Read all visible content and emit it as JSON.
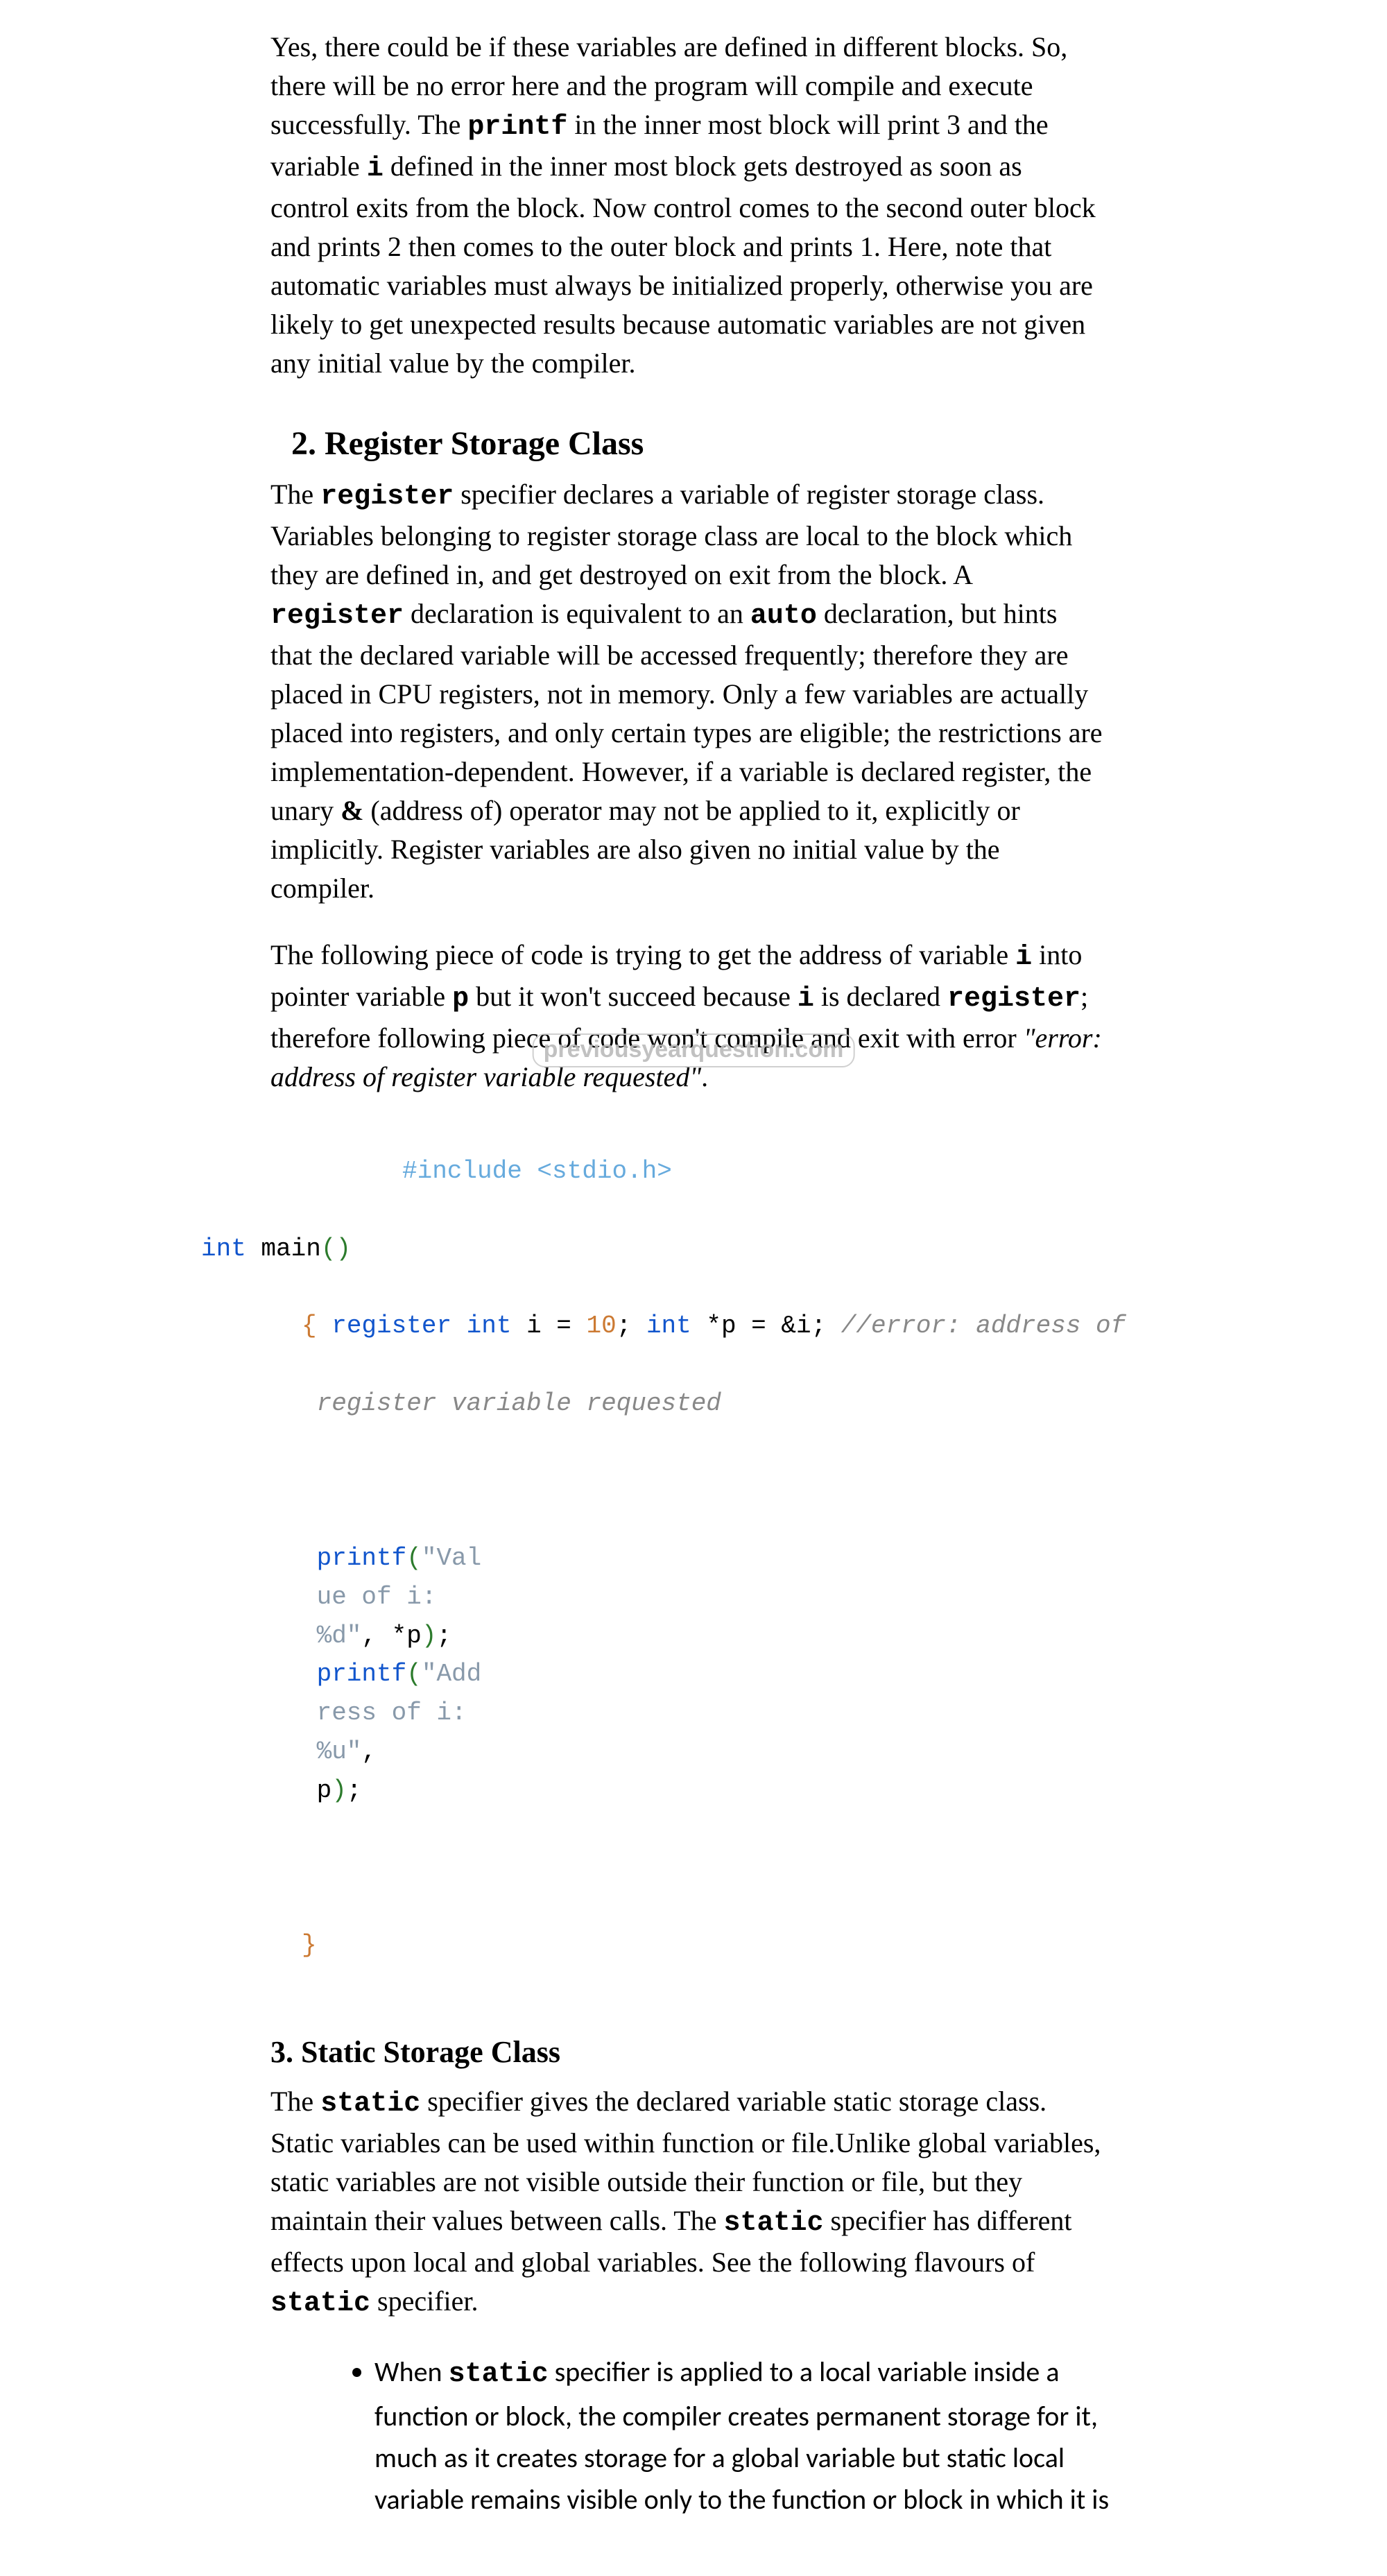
{
  "para1": {
    "t0": "Yes, there could be if these variables are defined in different blocks. So, there will be no error here and the program will compile and execute successfully. The ",
    "c0": "printf",
    "t1": " in the inner most block will print 3 and the variable ",
    "c1": "i",
    "t2": " defined in the inner most block gets destroyed as soon as control exits from the block. Now control comes to the second outer block and prints 2 then comes to the outer block and prints 1. Here, note that automatic variables must always be initialized properly, otherwise you are likely to get unexpected results because automatic variables are not given any initial value by the compiler."
  },
  "h2": "2. Register Storage Class",
  "para2": {
    "t0": "The ",
    "c0": "register",
    "t1": " specifier declares a variable of register storage class. Variables belonging to register storage class are local to the block which they are defined in, and get destroyed on exit from the block. A ",
    "c1": "register",
    "t2": " declaration is equivalent to an ",
    "c2": "auto",
    "t3": " declaration, but hints that the declared variable will be accessed frequently; therefore they are placed in CPU registers, not in memory. Only a few variables are actually placed into registers, and only certain types are eligible; the restrictions are implementation-dependent. However, if a variable is declared register, the unary ",
    "amp": "&",
    "t4": " (address of) operator may not be applied to it, explicitly or implicitly. Register variables are also given no initial value by the compiler."
  },
  "para3": {
    "t0": "The following piece of code is trying to get the address of variable ",
    "c0": "i",
    "t1": " into pointer variable ",
    "c1": "p",
    "t2": " but it won't succeed because ",
    "c2": "i",
    "t3": " is declared ",
    "c3": "register",
    "t4": "; therefore following piece of code won't compile and exit with error ",
    "em": "\"error: address of register variable requested\"",
    "t5": "."
  },
  "code": {
    "include": "#include <stdio.h>",
    "intmain_int": "int",
    "intmain_main": " main",
    "intmain_paren": "()",
    "l_open_brace": "{",
    "l1_kw_register": " register ",
    "l1_kw_int": "int",
    "l1_mid": " i = ",
    "l1_num": "10",
    "l1_semi": "; ",
    "l1_int": "int",
    "l1_rest": " *p = &i; ",
    "l1_cmt": "//error: address of",
    "l2_cmt": " register variable requested",
    "p1a": " printf",
    "p1a_p1": "(",
    "p1a_s": "\"Val\n ue of i:\n %d\"",
    "p1a_mid": ", *p",
    "p1a_p2": ")",
    "p1a_semi": ";",
    "p2a": " printf",
    "p2a_p1": "(",
    "p2a_s": "\"Add\n ress of i:\n %u\"",
    "p2a_mid": ",\n p",
    "p2a_p2": ")",
    "p2a_semi": ";",
    "close_brace": "}"
  },
  "h3": "3. Static Storage Class",
  "para4": {
    "t0": "The ",
    "c0": "static",
    "t1": " specifier gives the declared variable static storage class. Static variables can be used within function or file.Unlike global variables, static variables are not visible outside their function or file, but they maintain their values between calls. The ",
    "c1": "static",
    "t2": " specifier has different effects upon local and global variables. See the following flavours of ",
    "c2": "static",
    "t3": " specifier."
  },
  "bullet1": {
    "t0": "When ",
    "c0": "static",
    "t1": " specifier is applied to a local variable inside a function or block, the compiler creates permanent storage for it, much as it creates storage for a global variable but static local variable remains visible only to the function or block in which it is"
  },
  "watermark": "previousyearquestion.com"
}
